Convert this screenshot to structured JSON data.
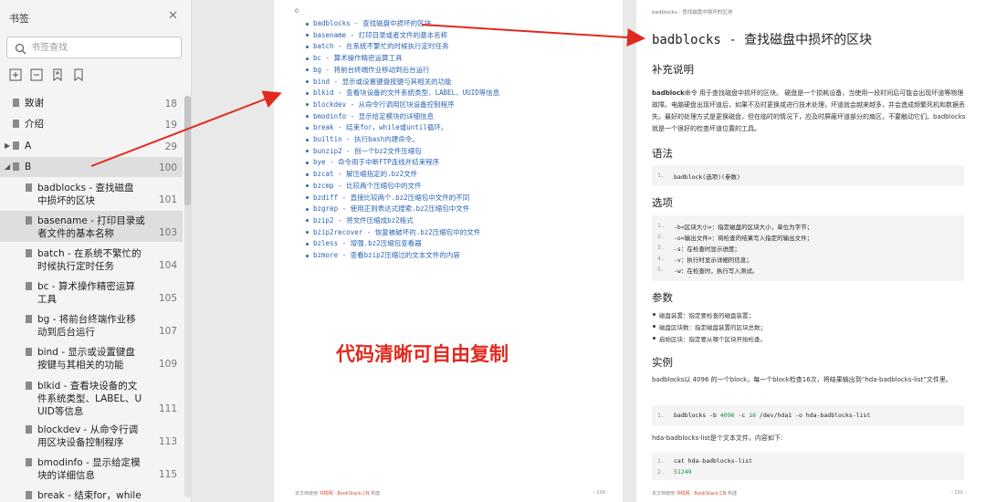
{
  "sidebar": {
    "title": "书签",
    "search_placeholder": "书签查找",
    "items": [
      {
        "label": "致谢",
        "page": "18",
        "expand": "",
        "indent": 0
      },
      {
        "label": "介绍",
        "page": "19",
        "expand": "",
        "indent": 0
      },
      {
        "label": "A",
        "page": "29",
        "expand": "collapsed",
        "indent": 0
      },
      {
        "label": "B",
        "page": "100",
        "expand": "expanded",
        "indent": 0
      },
      {
        "label": "badblocks - 查找磁盘\n中损坏的区块",
        "page": "101",
        "indent": 1
      },
      {
        "label": "basename - 打印目录或\n者文件的基本名称",
        "page": "103",
        "indent": 1
      },
      {
        "label": "batch - 在系统不繁忙的\n时候执行定时任务",
        "page": "104",
        "indent": 1
      },
      {
        "label": "bc - 算术操作精密运算\n工具",
        "page": "105",
        "indent": 1
      },
      {
        "label": "bg - 将前台终端作业移\n动到后台运行",
        "page": "107",
        "indent": 1
      },
      {
        "label": "bind - 显示或设置键盘\n按键与其相关的功能",
        "page": "109",
        "indent": 1
      },
      {
        "label": "blkid - 查看块设备的文\n件系统类型、LABEL、U\nUID等信息",
        "page": "111",
        "indent": 1
      },
      {
        "label": "blockdev - 从命令行调\n用区块设备控制程序",
        "page": "113",
        "indent": 1
      },
      {
        "label": "bmodinfo - 显示给定模\n块的详细信息",
        "page": "115",
        "indent": 1
      },
      {
        "label": "break - 结束for，while",
        "page": "",
        "indent": 1
      }
    ]
  },
  "left_page": {
    "page_marker": "0",
    "commands": [
      "badblocks - 查找磁盘中损坏的区块",
      "basename - 打印目录或者文件的基本名称",
      "batch - 在系统不繁忙的时候执行定时任务",
      "bc - 算术操作精密运算工具",
      "bg - 将前台终端作业移动到后台运行",
      "bind - 显示或设置键盘按键与其相关的功能",
      "blkid - 查看块设备的文件系统类型、LABEL、UUID等信息",
      "blockdev - 从命令行调用区块设备控制程序",
      "bmodinfo - 显示给定模块的详细信息",
      "break - 结束for，while或until循环。",
      "builtin - 执行bash内建命令。",
      "bunzip2 - 创一个bz2文件压缩包",
      "bye - 命令用于中断FTP连线并结束程序",
      "bzcat - 解压缩指定的.bz2文件",
      "bzcmp - 比较两个压缩包中的文件",
      "bzdiff - 直接比较两个.bz2压缩包中文件的不同",
      "bzgrep - 使用正则表达式搜索.bz2压缩包中文件",
      "bzip2 - 将文件压缩成bz2格式",
      "bzip2recover - 恢复被破坏的.bz2压缩包中的文件",
      "bzless - 增强.bz2压缩包查看器",
      "bzmore - 查看bzip2压缩过的文本文件的内容"
    ],
    "footer_prefix": "本文档使用",
    "footer_brand": "书栈网 · BookStack.CN",
    "footer_suffix": "构建",
    "footer_page": "- 100 -"
  },
  "overlay_text": "代码清晰可自由复制",
  "right_page": {
    "breadcrumb": "badblocks - 查找磁盘中损坏的区块",
    "title": "badblocks - 查找磁盘中损坏的区块",
    "h_extra": "补充说明",
    "para1_bold": "badblock",
    "para1": "命令 用于查找磁盘中损坏的区块。 硬盘是一个损耗设备，当使用一段时间后可能会出现坏道等物理故障。电脑硬盘出现坏道后，如果不及时更换或进行技术处理，坏道就会越来越多，并会造成频繁死机和数据丢失。最好的处理方式是更换磁盘，但在临时的情况下，应及时屏蔽坏道部分的扇区，不要触动它们。badblocks就是一个很好的检查坏道位置的工具。",
    "h_syntax": "语法",
    "syntax_code": "badblock(选项)(参数)",
    "h_options": "选项",
    "options": [
      "-b<区块大小>：指定磁盘的区块大小，单位为字节；",
      "-o<输出文件>：将检查的结果写入指定的输出文件；",
      "-s：在检查时显示进度；",
      "-v：执行时显示详细的信息；",
      "-w：在检查时，执行写入测试。"
    ],
    "h_params": "参数",
    "params": [
      "磁盘装置：指定要检查的磁盘装置；",
      "磁盘区块数：指定磁盘装置的区块总数；",
      "启始区块：指定要从哪个区块开始检查。"
    ],
    "h_examples": "实例",
    "example_para": "badblocks以 4096 的一个block，每一个block检查16次，将结果输出到“hda-badblocks-list”文件里。",
    "example_code_pre": "badblocks -b ",
    "example_code_n1": "4096",
    "example_code_mid": " -c ",
    "example_code_n2": "16",
    "example_code_post": " /dev/hda1 -o hda-badblocks-list",
    "example_para2": "hda-badblocks-list是个文本文件，内容如下:",
    "example2_line1": "cat hda-badblocks-list",
    "example2_line2": "51249",
    "footer_page": "- 101 -"
  }
}
